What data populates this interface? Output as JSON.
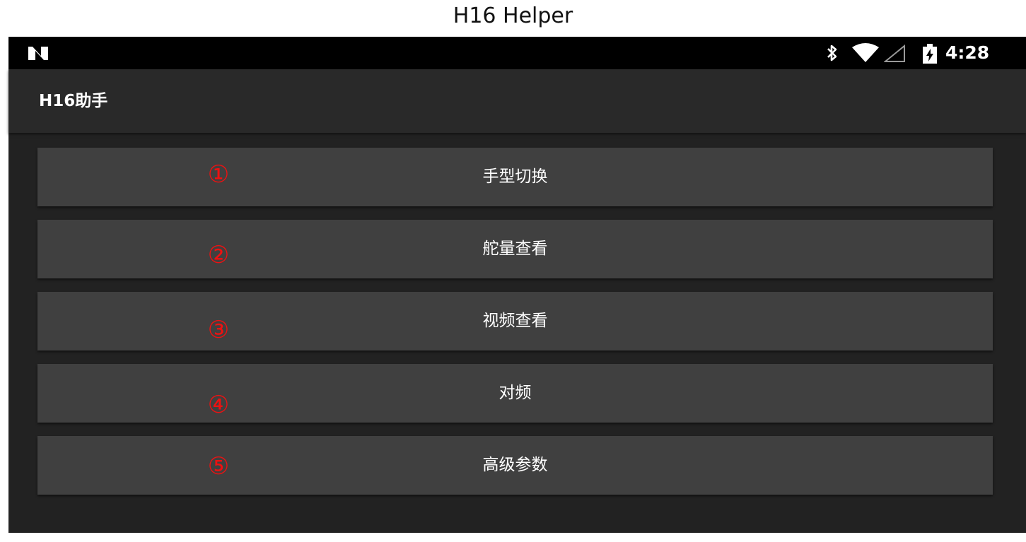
{
  "caption": "H16 Helper",
  "status_bar": {
    "notification_icon": "n-logo-icon",
    "icons": [
      "bluetooth-icon",
      "wifi-icon",
      "cell-signal-icon",
      "battery-charging-icon"
    ],
    "time": "4:28"
  },
  "app_bar": {
    "title": "H16助手"
  },
  "menu": [
    {
      "label": "手型切换",
      "annotation": "①"
    },
    {
      "label": "舵量查看",
      "annotation": "②"
    },
    {
      "label": "视频查看",
      "annotation": "③"
    },
    {
      "label": "对频",
      "annotation": "④"
    },
    {
      "label": "高级参数",
      "annotation": "⑤"
    }
  ],
  "colors": {
    "status_bar": "#000000",
    "app_bar": "#292929",
    "background": "#222222",
    "button": "#404040",
    "annotation": "#ee1111"
  }
}
